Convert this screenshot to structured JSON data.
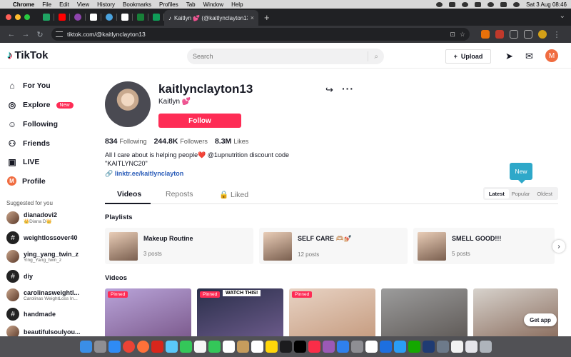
{
  "menubar": {
    "app": "Chrome",
    "items": [
      "File",
      "Edit",
      "View",
      "History",
      "Bookmarks",
      "Profiles",
      "Tab",
      "Window",
      "Help"
    ],
    "datetime": "Sat 3 Aug  08:46"
  },
  "browser": {
    "active_tab_title": "Kaitlyn 💕 (@kaitlynclayton13)",
    "url": "tiktok.com/@kaitlynclayton13",
    "pinned_tab_icons": [
      "docs-icon",
      "youtube-icon",
      "podcast-icon",
      "gmail-icon",
      "camera-icon",
      "gmail-icon",
      "sheets-icon",
      "sheets-icon"
    ]
  },
  "header": {
    "logo": "TikTok",
    "search_placeholder": "Search",
    "upload_label": "Upload",
    "avatar_letter": "M"
  },
  "sidebar": {
    "nav": [
      {
        "label": "For You",
        "icon": "home-icon"
      },
      {
        "label": "Explore",
        "icon": "compass-icon",
        "badge": "New"
      },
      {
        "label": "Following",
        "icon": "following-icon"
      },
      {
        "label": "Friends",
        "icon": "friends-icon"
      },
      {
        "label": "LIVE",
        "icon": "live-icon"
      },
      {
        "label": "Profile",
        "icon": "profile-icon",
        "avatar": "M"
      }
    ],
    "suggested_title": "Suggested for you",
    "suggested": [
      {
        "name": "dianadovi2",
        "sub": "👑Diana D👑",
        "photo": true
      },
      {
        "name": "weightlossover40",
        "sub": "",
        "photo": false
      },
      {
        "name": "ying_yang_twin_z",
        "sub": "Ying_Yang_twin_z",
        "photo": true
      },
      {
        "name": "diy",
        "sub": "",
        "photo": false
      },
      {
        "name": "carolinasweightl...",
        "sub": "Carolinas WeightLoss Ιn...",
        "photo": true
      },
      {
        "name": "handmade",
        "sub": "",
        "photo": false
      },
      {
        "name": "beautifulsoulyou...",
        "sub": "",
        "photo": true
      }
    ]
  },
  "profile": {
    "username": "kaitlynclayton13",
    "display_name": "Kaitlyn 💕",
    "follow_label": "Follow",
    "stats": [
      {
        "value": "834",
        "label": "Following"
      },
      {
        "value": "244.8K",
        "label": "Followers"
      },
      {
        "value": "8.3M",
        "label": "Likes"
      }
    ],
    "bio_line1": "All I care about is helping people❤️ @1upnutrition discount code",
    "bio_line2": "\"KAITLYNC20\"",
    "link": "linktr.ee/kaitlynclayton",
    "tabs": [
      "Videos",
      "Reposts",
      "Liked"
    ],
    "sort_options": [
      "Latest",
      "Popular",
      "Oldest"
    ],
    "sort_selected": "Latest",
    "new_tooltip": "New"
  },
  "playlists": {
    "title": "Playlists",
    "items": [
      {
        "name": "Makeup Routine",
        "count": "3 posts"
      },
      {
        "name": "SELF CARE 🫶🏼💅🏼",
        "count": "12 posts"
      },
      {
        "name": "SMELL GOOD!!!",
        "count": "5 posts"
      }
    ]
  },
  "videos": {
    "title": "Videos",
    "items": [
      {
        "pinned": "Pinned",
        "caption": "",
        "colors": [
          "#b9a4d9",
          "#7c5a8d"
        ]
      },
      {
        "pinned": "Pinned",
        "caption": "WATCH THIS!",
        "colors": [
          "#2a2f4a",
          "#6b5a8a"
        ]
      },
      {
        "pinned": "Pinned",
        "caption": "",
        "colors": [
          "#e8d3c4",
          "#c69c80"
        ]
      },
      {
        "pinned": "",
        "caption": "",
        "colors": [
          "#9c9c9c",
          "#5f5a57"
        ]
      },
      {
        "pinned": "",
        "caption": "",
        "colors": [
          "#d7d2cc",
          "#8b6e5f"
        ]
      }
    ],
    "get_app": "Get app"
  }
}
